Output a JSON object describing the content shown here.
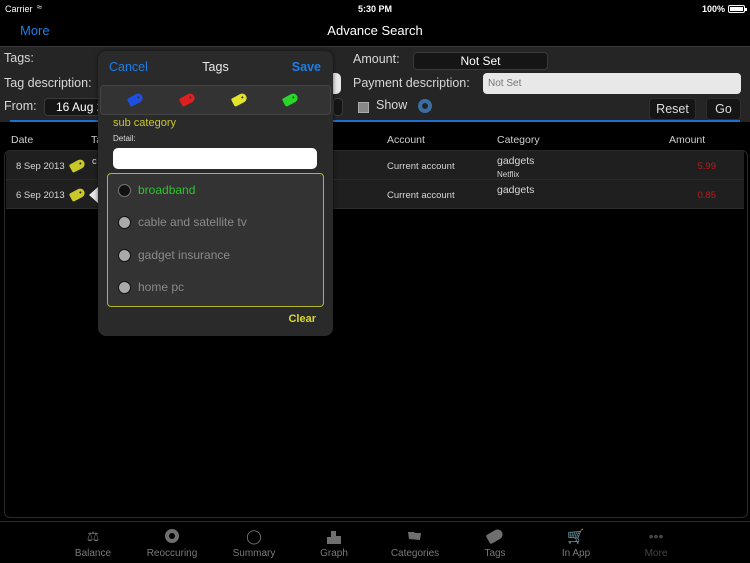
{
  "status_bar": {
    "carrier": "Carrier",
    "wifi_icon": "wifi-icon",
    "time": "5:30 PM",
    "battery": "100%"
  },
  "nav": {
    "back_label": "More",
    "title": "Advance Search"
  },
  "filters": {
    "tags_label": "Tags:",
    "tag_description_label": "Tag description:",
    "from_label": "From:",
    "from_value": "16 Aug 2",
    "amount_label": "Amount:",
    "amount_value": "Not Set",
    "payment_description_label": "Payment description:",
    "payment_description_placeholder": "Not Set",
    "show_label": "Show",
    "reset_label": "Reset",
    "go_label": "Go"
  },
  "table": {
    "columns": [
      "Date",
      "Ta",
      "Account",
      "Category",
      "Amount"
    ],
    "rows": [
      {
        "date": "8 Sep 2013",
        "tag_text": "c",
        "account": "Current account",
        "category": "gadgets",
        "subcategory": "Netflix",
        "amount": "5.99"
      },
      {
        "date": "6 Sep 2013",
        "tag_text": "",
        "account": "Current account",
        "category": "gadgets",
        "subcategory": "",
        "amount": "0.85"
      }
    ]
  },
  "popover": {
    "cancel_label": "Cancel",
    "title": "Tags",
    "save_label": "Save",
    "color_tags": [
      {
        "name": "blue",
        "color": "#1f4fe0"
      },
      {
        "name": "red",
        "color": "#e01f1f"
      },
      {
        "name": "yellow",
        "color": "#e3e32a"
      },
      {
        "name": "green",
        "color": "#2ad62a"
      }
    ],
    "sub_category_label": "sub category",
    "detail_label": "Detail:",
    "detail_value": "",
    "options": [
      {
        "label": "broadband",
        "selected": true
      },
      {
        "label": "cable and satellite tv",
        "selected": false
      },
      {
        "label": "gadget insurance",
        "selected": false
      },
      {
        "label": "home pc",
        "selected": false
      }
    ],
    "clear_label": "Clear"
  },
  "tab_bar": {
    "items": [
      {
        "label": "Balance",
        "icon": "scale-icon"
      },
      {
        "label": "Reoccuring",
        "icon": "cycle-icon"
      },
      {
        "label": "Summary",
        "icon": "piggy-bank-icon"
      },
      {
        "label": "Graph",
        "icon": "bar-graph-icon"
      },
      {
        "label": "Categories",
        "icon": "folder-icon"
      },
      {
        "label": "Tags",
        "icon": "tag-icon"
      },
      {
        "label": "In App",
        "icon": "cart-icon"
      },
      {
        "label": "More",
        "icon": "more-icon"
      }
    ]
  }
}
